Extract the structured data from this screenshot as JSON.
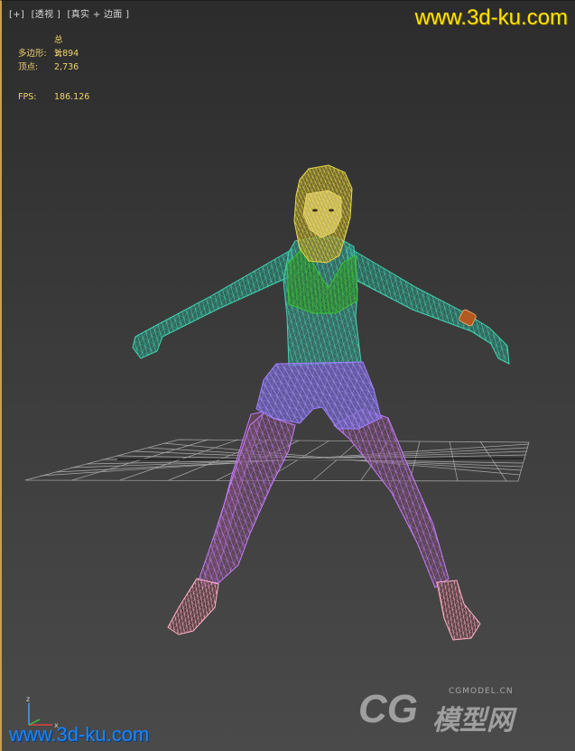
{
  "viewport": {
    "label_plus": "[+]",
    "label_view": "[透视 ]",
    "label_shading": "[真实 + 边面 ]"
  },
  "stats": {
    "total_label": "总计",
    "polygons_label": "多边形:",
    "polygons_value": "3,894",
    "vertices_label": "顶点:",
    "vertices_value": "2,736",
    "fps_label": "FPS:",
    "fps_value": "186.126"
  },
  "watermarks": {
    "top": "www.3d-ku.com",
    "bottom": "www.3d-ku.com",
    "cg_mark": "CG",
    "cg_cn": "模型网",
    "cg_url": "CGMODEL.CN"
  },
  "axis": {
    "z_label": "z",
    "x_label": "x"
  },
  "colors": {
    "stats_text": "#f0d36a",
    "watermark_top": "#ffe400",
    "watermark_bottom": "#1a86ff",
    "viewport_border": "#c9a14a",
    "wire_head": "#e8d84a",
    "wire_body": "#3fd6b0",
    "wire_top": "#3cc23c",
    "wire_shorts": "#a07cff",
    "wire_legs": "#c97cff",
    "wire_shoes": "#ffb0c8"
  }
}
